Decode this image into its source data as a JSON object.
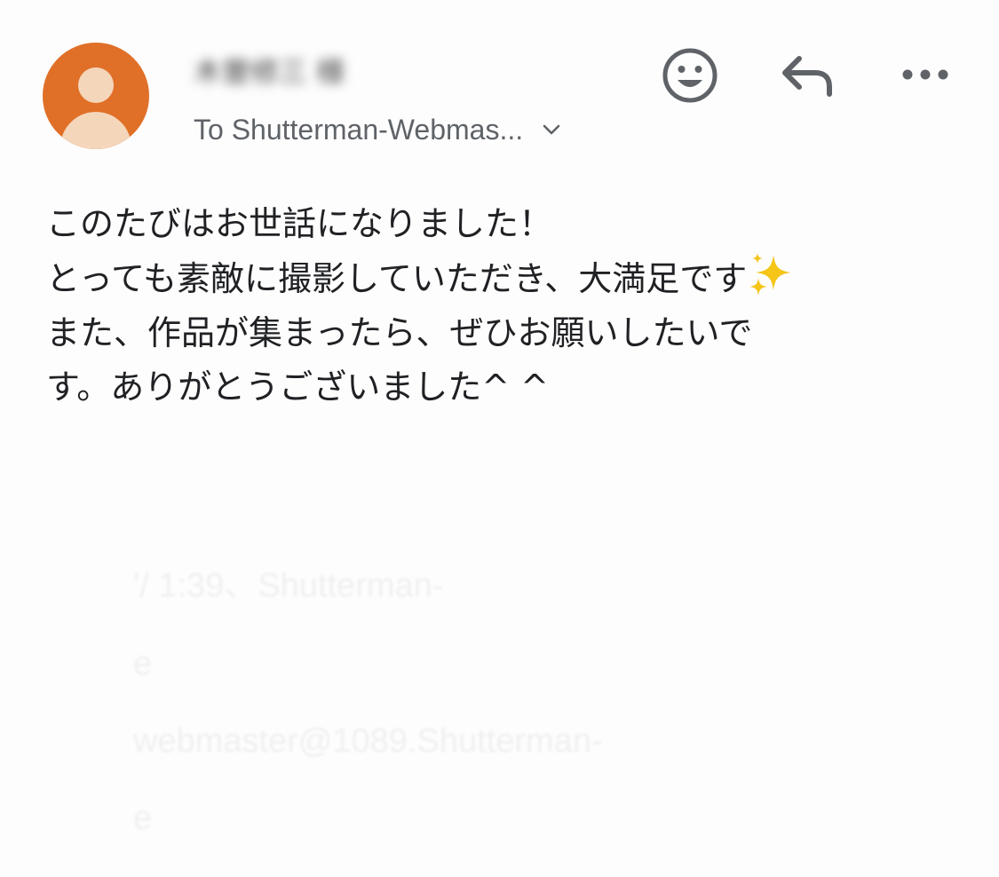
{
  "header": {
    "sender_name": "木曽修三 様",
    "recipient": "To Shutterman-Webmas...",
    "icons": {
      "avatar": "person-avatar",
      "react": "smiley-face-icon",
      "reply": "reply-arrow-icon",
      "more": "more-horizontal-icon",
      "expand": "chevron-down-icon"
    }
  },
  "message": {
    "lines": [
      "このたびはお世話になりました！",
      "とっても素敵に撮影していただき、大満足です",
      "また、作品が集まったら、ぜひお願いしたいで",
      "す。ありがとうございました^ ^"
    ]
  },
  "quoted": {
    "lines": [
      "'/      1:39、Shutterman-",
      "e",
      "webmaster@1089.Shutterman-",
      "e"
    ]
  },
  "colors": {
    "avatar_bg": "#e07028",
    "avatar_fg": "#f4d6bb",
    "icon": "#5f6368",
    "text": "#202124",
    "sparkle": "#f5c518"
  }
}
